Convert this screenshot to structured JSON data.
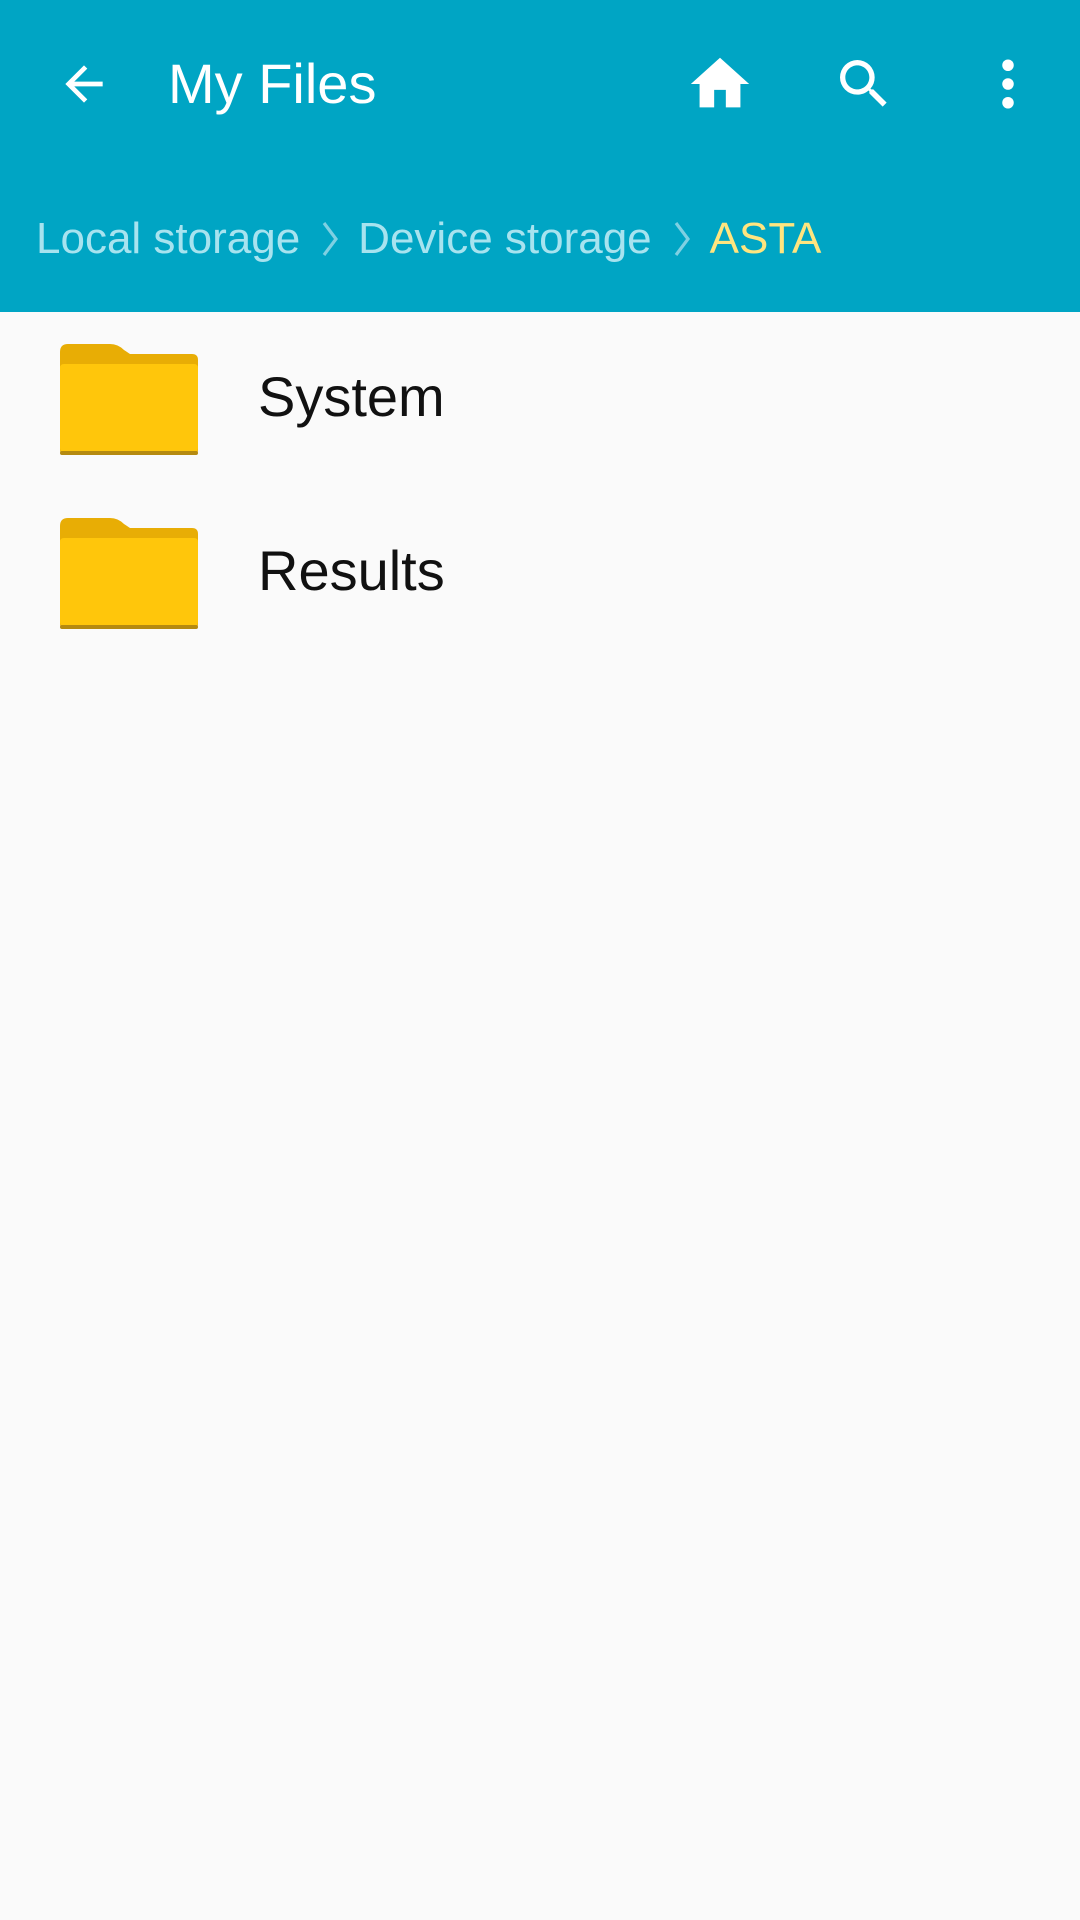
{
  "app": {
    "title": "My Files"
  },
  "toolbar": {
    "back_icon": "back-arrow-icon",
    "home_icon": "home-icon",
    "search_icon": "search-icon",
    "more_icon": "more-vert-icon"
  },
  "breadcrumb": {
    "items": [
      "Local storage",
      "Device storage",
      "ASTA"
    ],
    "separator_icon": "chevron-right-icon"
  },
  "files": [
    {
      "name": "System",
      "icon": "folder-icon"
    },
    {
      "name": "Results",
      "icon": "folder-icon"
    }
  ],
  "colors": {
    "header": "#00a5c4",
    "breadcrumb_text": "#a7e3ef",
    "breadcrumb_current": "#ffe57f",
    "folder": "#ffc20e",
    "background": "#fafafa"
  }
}
